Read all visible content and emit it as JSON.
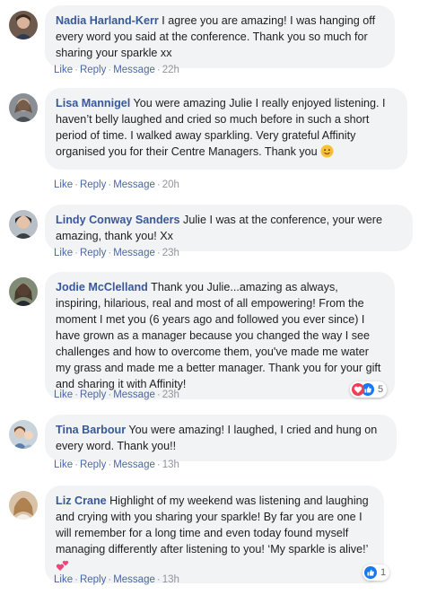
{
  "comments": [
    {
      "author": "Nadia Harland-Kerr",
      "text": " I agree you are amazing! I was hanging off every word you said at the conference. Thank you so much for sharing your sparkle xx",
      "actions": {
        "like": "Like",
        "reply": "Reply",
        "message": "Message",
        "time": "22h"
      }
    },
    {
      "author": "Lisa Mannigel",
      "text": " You were amazing Julie I really enjoyed listening. I haven’t belly laughed and cried so much before in such a short period of time. I walked away sparkling. Very grateful Affinity organised you for their Centre Managers. Thank you ",
      "emoji": "smiling-face-emoji",
      "actions": {
        "like": "Like",
        "reply": "Reply",
        "message": "Message",
        "time": "20h"
      }
    },
    {
      "author": "Lindy Conway Sanders",
      "text": " Julie I was at the conference, your were amazing, thank you! Xx",
      "actions": {
        "like": "Like",
        "reply": "Reply",
        "message": "Message",
        "time": "23h"
      }
    },
    {
      "author": "Jodie McClelland",
      "text": " Thank you Julie...amazing as always, inspiring, hilarious, real and most of all empowering! From the moment I met you (6 years ago and followed you ever since) I have grown as a manager because you changed the way I see challenges and how to overcome them, you've made me water my grass and made me a better manager. Thank you for your gift and sharing it with Affinity!",
      "actions": {
        "like": "Like",
        "reply": "Reply",
        "message": "Message",
        "time": "23h"
      },
      "reactions": {
        "icons": [
          "love-reaction-icon",
          "like-reaction-icon"
        ],
        "count": "5"
      }
    },
    {
      "author": "Tina Barbour",
      "text": " You were amazing! I laughed, I cried and hung on every word. Thank you!!",
      "actions": {
        "like": "Like",
        "reply": "Reply",
        "message": "Message",
        "time": "13h"
      }
    },
    {
      "author": "Liz Crane",
      "text": " Highlight of my weekend was listening and laughing and crying with you sharing your sparkle! By far you are one I will remember for a long time and even today found myself managing differently after listening to you! ‘My sparkle is alive!’",
      "emoji": "two-hearts-emoji",
      "actions": {
        "like": "Like",
        "reply": "Reply",
        "message": "Message",
        "time": "13h"
      },
      "reactions": {
        "icons": [
          "like-reaction-icon"
        ],
        "count": "1"
      }
    }
  ],
  "colors": {
    "author": "#385898",
    "link": "#4b67a1",
    "meta": "#90949c",
    "bubble": "#f2f3f5",
    "like_blue": "#1877f2",
    "love_red": "#f33e58"
  }
}
